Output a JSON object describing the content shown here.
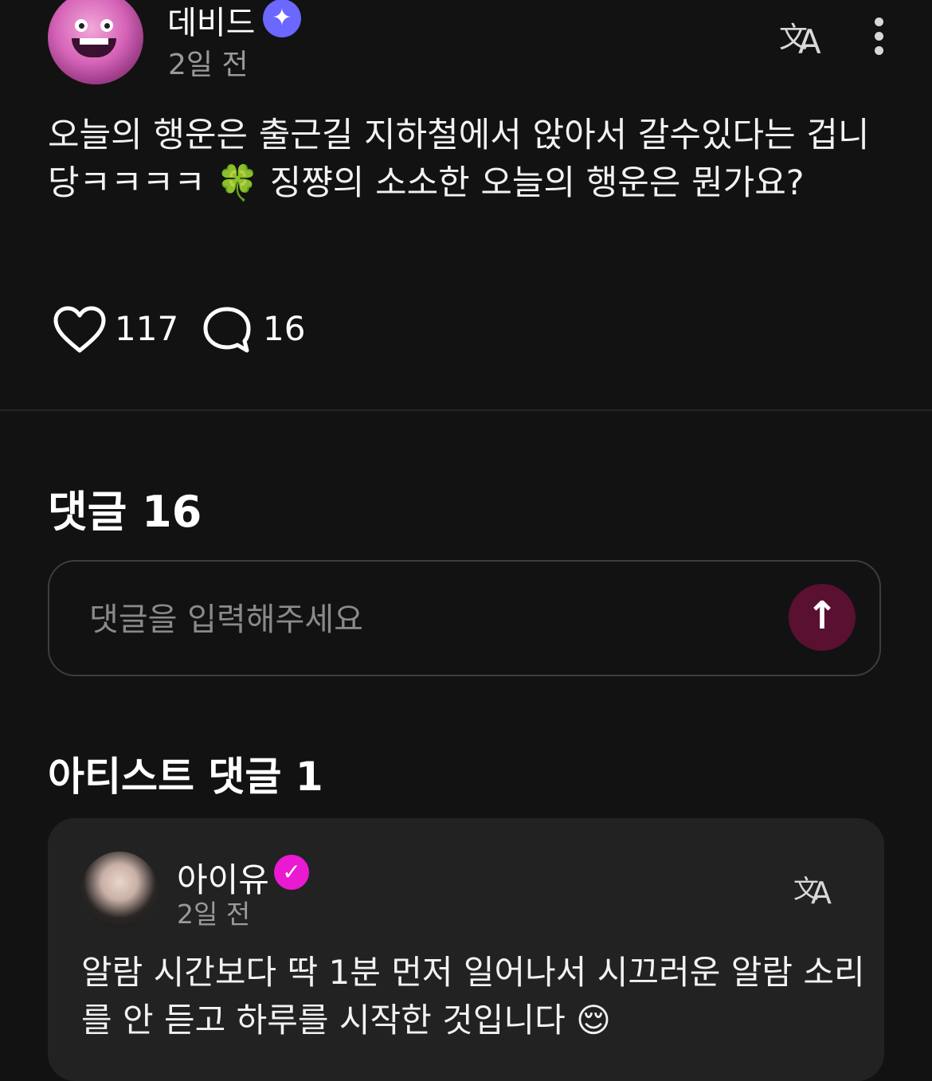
{
  "post": {
    "author_name": "데비드",
    "verified_icon": "sparkle-verified-icon",
    "time": "2일 전",
    "body": "오늘의 행운은 출근길 지하철에서 앉아서 갈수있다는 겁니당ㅋㅋㅋㅋ 🍀 징쨩의 소소한 오늘의 행운은 뭔가요?",
    "like_count": "117",
    "comment_count": "16"
  },
  "comments_section": {
    "title": "댓글 16",
    "input_placeholder": "댓글을 입력해주세요",
    "send_icon": "arrow-up-icon"
  },
  "artist_comments": {
    "title": "아티스트 댓글 1",
    "items": [
      {
        "author_name": "아이유",
        "time": "2일 전",
        "text": "알람 시간보다 딱 1분 먼저 일어나서 시끄러운 알람 소리를 안 듣고 하루를 시작한 것입니다 😌"
      }
    ]
  },
  "colors": {
    "background": "#121212",
    "card": "#222222",
    "send_button": "#5a1030",
    "badge_blue": "#6b67ff",
    "badge_pink": "#e91ad1"
  }
}
